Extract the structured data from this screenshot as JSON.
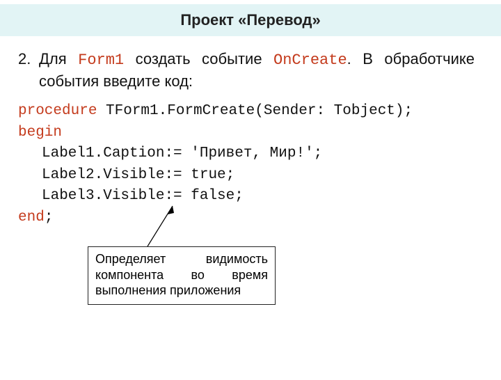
{
  "title": "Проект «Перевод»",
  "step_number": "2.",
  "instruction_parts": {
    "p1": "Для ",
    "c1": "Form1",
    "p2": " создать событие ",
    "c2": "OnCreate",
    "p3": ". В обработчике события введите код:"
  },
  "code": {
    "l1a": "procedure",
    "l1b": " TForm1.FormCreate(Sender: Tobject);",
    "l2": "begin",
    "l3a": "Label1.Caption",
    "l3b": ":= 'Привет, Мир!';",
    "l4a": "Label2.Visible",
    "l4b": ":= ",
    "l4c": "true",
    "l4d": ";",
    "l5a": "Label3.Visible",
    "l5b": ":= ",
    "l5c": "false",
    "l5d": ";",
    "l6a": "end",
    "l6b": ";"
  },
  "note": "Определяет видимость компонента во время выполнения приложения"
}
